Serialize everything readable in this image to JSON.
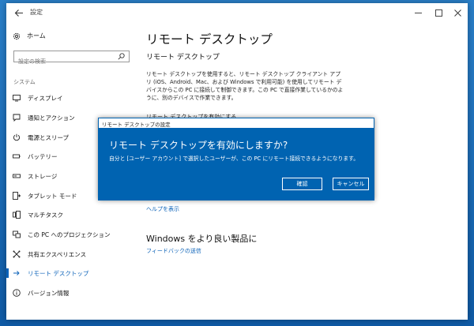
{
  "window": {
    "title": "設定"
  },
  "sidebar": {
    "home_label": "ホーム",
    "search_placeholder": "設定の検索",
    "section_label": "システム",
    "items": [
      {
        "label": "ディスプレイ",
        "icon": "display-icon"
      },
      {
        "label": "通知とアクション",
        "icon": "notification-icon"
      },
      {
        "label": "電源とスリープ",
        "icon": "power-icon"
      },
      {
        "label": "バッテリー",
        "icon": "battery-icon"
      },
      {
        "label": "ストレージ",
        "icon": "storage-icon"
      },
      {
        "label": "タブレット モード",
        "icon": "tablet-mode-icon"
      },
      {
        "label": "マルチタスク",
        "icon": "multitask-icon"
      },
      {
        "label": "この PC へのプロジェクション",
        "icon": "projection-icon"
      },
      {
        "label": "共有エクスペリエンス",
        "icon": "shared-experience-icon"
      },
      {
        "label": "リモート デスクトップ",
        "icon": "remote-desktop-icon",
        "active": true
      },
      {
        "label": "バージョン情報",
        "icon": "info-icon"
      }
    ]
  },
  "main": {
    "title": "リモート デスクトップ",
    "subtitle": "リモート デスクトップ",
    "description": "リモート デスクトップを使用すると、リモート デスクトップ クライアント アプリ (iOS、Android、Mac、および Windows で利用可能) を使用してリモート デバイスからこの PC に接続して制御できます。この PC で直接作業しているかのように、別のデバイスで作業できます。",
    "toggle_label": "リモート デスクトップを有効にする",
    "help_link": "ヘルプを表示",
    "improve_title": "Windows をより良い製品に",
    "feedback_link": "フィードバックの送信"
  },
  "dialog": {
    "title": "リモート デスクトップの設定",
    "heading": "リモート デスクトップを有効にしますか?",
    "message": "自分と [ユーザー アカウント] で選択したユーザーが、この PC にリモート接続できるようになります。",
    "confirm_label": "確認",
    "cancel_label": "キャンセル"
  },
  "colors": {
    "accent": "#0b62b8",
    "dialog_bg": "#0063b1"
  }
}
